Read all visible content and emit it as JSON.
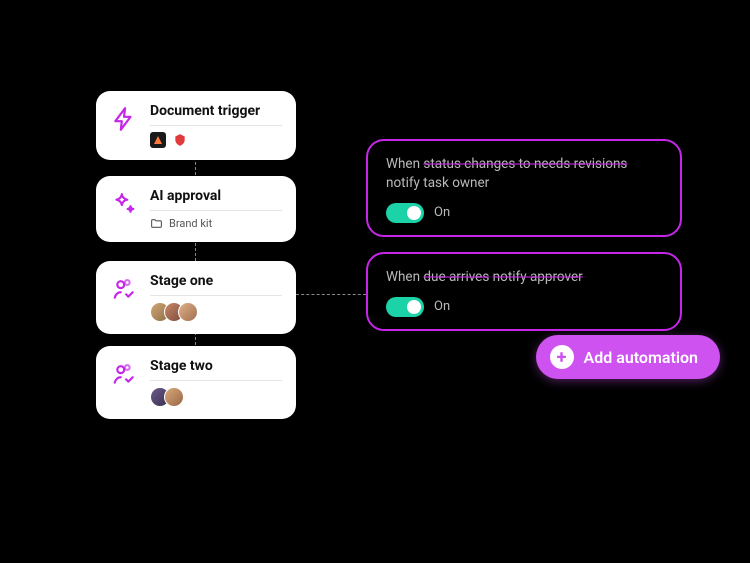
{
  "stages": {
    "trigger": {
      "title": "Document trigger"
    },
    "ai": {
      "title": "AI approval",
      "meta": "Brand kit"
    },
    "one": {
      "title": "Stage one"
    },
    "two": {
      "title": "Stage two"
    }
  },
  "automations": {
    "rev": {
      "prefix": "When",
      "mid1": "status changes to needs revisions",
      "suffix": "notify task owner",
      "state_label": "On"
    },
    "due": {
      "prefix": "When",
      "mid1": "due arrives",
      "mid2": "notify approver",
      "state_label": "On"
    }
  },
  "add_button": "Add automation",
  "colors": {
    "accent": "#c526e8",
    "pill": "#ce52f0",
    "toggle_on": "#1cd3a8"
  }
}
